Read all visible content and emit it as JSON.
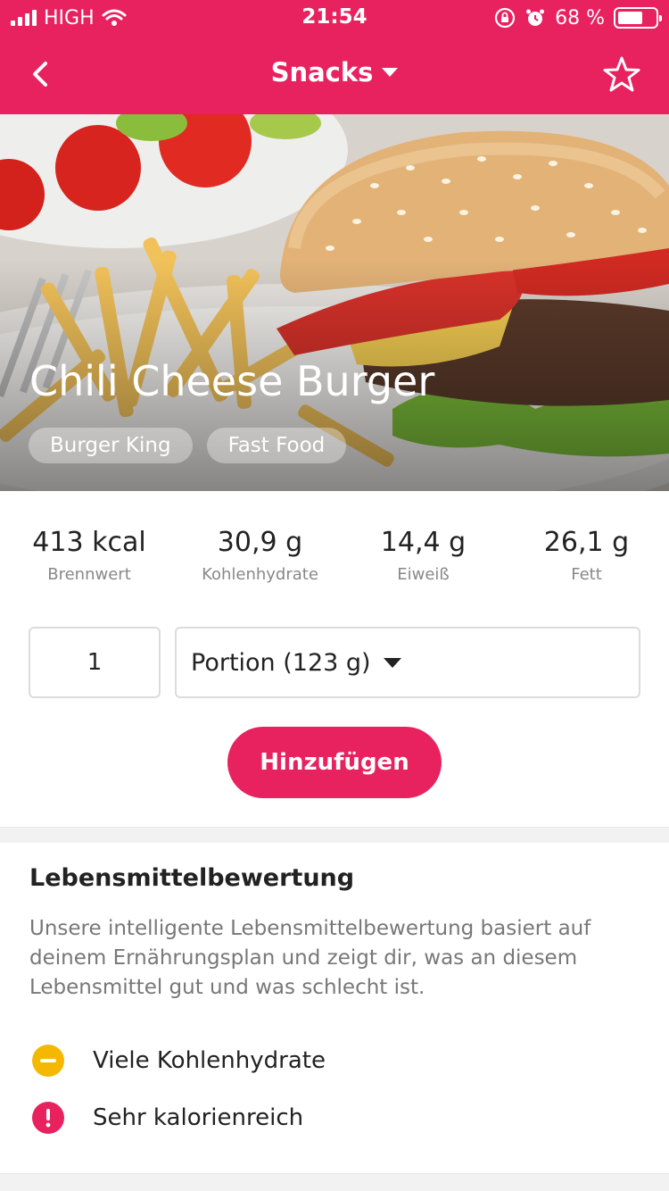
{
  "status_bar": {
    "carrier": "HIGH",
    "time": "21:54",
    "battery_text": "68 %",
    "battery_level": 0.68
  },
  "nav": {
    "title": "Snacks",
    "back_icon": "chevron-left-icon",
    "favorite_icon": "star-outline-icon"
  },
  "hero": {
    "title": "Chili Cheese Burger",
    "tags": [
      "Burger King",
      "Fast Food"
    ]
  },
  "nutrition": [
    {
      "value": "413 kcal",
      "label": "Brennwert"
    },
    {
      "value": "30,9 g",
      "label": "Kohlenhydrate"
    },
    {
      "value": "14,4 g",
      "label": "Eiweiß"
    },
    {
      "value": "26,1 g",
      "label": "Fett"
    }
  ],
  "portion": {
    "quantity": "1",
    "unit": "Portion (123 g)"
  },
  "add_button": "Hinzufügen",
  "rating": {
    "title": "Lebensmittelbewertung",
    "description": "Unsere intelligente Lebensmittelbewertung basiert auf deinem Ernährungsplan und zeigt dir, was an diesem Lebensmittel gut und was schlecht ist.",
    "items": [
      {
        "label": "Viele Kohlenhydrate",
        "icon": "minus-circle-icon",
        "color": "#f5b800"
      },
      {
        "label": "Sehr kalorienreich",
        "icon": "exclamation-circle-icon",
        "color": "#e8215f"
      }
    ]
  },
  "colors": {
    "accent": "#e8215f",
    "warning": "#f5b800"
  }
}
